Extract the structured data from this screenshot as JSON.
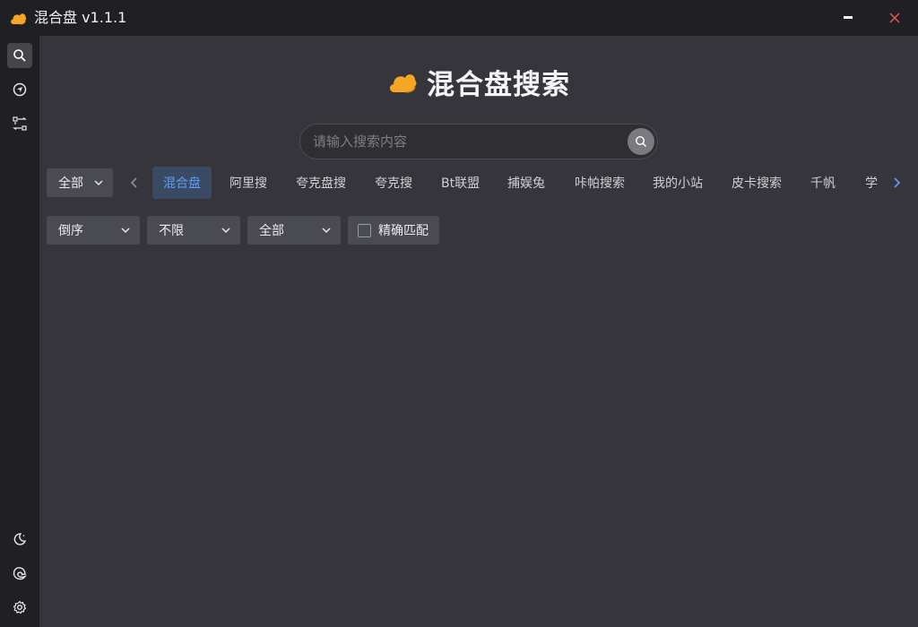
{
  "app": {
    "title": "混合盘 v1.1.1",
    "accent_color": "#5c9cf5",
    "logo_color": "#f5a623"
  },
  "titlebar": {
    "minimize_icon": "minimize-icon",
    "close_icon": "close-icon",
    "close_color": "#e05a5a"
  },
  "sidebar": {
    "items": [
      {
        "name": "search",
        "icon": "search-icon",
        "active": true
      },
      {
        "name": "navigate",
        "icon": "send-icon",
        "active": false
      },
      {
        "name": "transfer",
        "icon": "transfer-icon",
        "active": false
      }
    ],
    "bottom_items": [
      {
        "name": "theme",
        "icon": "moon-icon"
      },
      {
        "name": "browser",
        "icon": "edge-icon"
      },
      {
        "name": "settings",
        "icon": "gear-icon"
      }
    ]
  },
  "hero": {
    "title": "混合盘搜索"
  },
  "search": {
    "value": "",
    "placeholder": "请输入搜索内容"
  },
  "scope_select": {
    "value": "全部"
  },
  "tabs": [
    {
      "label": "混合盘",
      "active": true
    },
    {
      "label": "阿里搜",
      "active": false
    },
    {
      "label": "夸克盘搜",
      "active": false
    },
    {
      "label": "夸克搜",
      "active": false
    },
    {
      "label": "Bt联盟",
      "active": false
    },
    {
      "label": "捕娱兔",
      "active": false
    },
    {
      "label": "咔帕搜索",
      "active": false
    },
    {
      "label": "我的小站",
      "active": false
    },
    {
      "label": "皮卡搜索",
      "active": false
    },
    {
      "label": "千帆",
      "active": false
    },
    {
      "label": "学",
      "active": false
    }
  ],
  "filters": {
    "sort": "倒序",
    "time": "不限",
    "type": "全部",
    "exact_match_label": "精确匹配",
    "exact_match_checked": false
  }
}
